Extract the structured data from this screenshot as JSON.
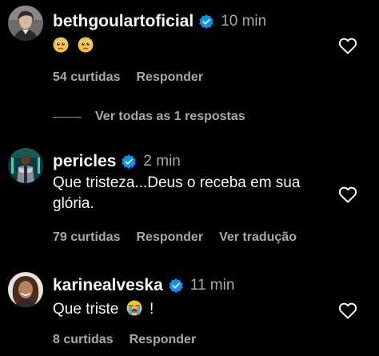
{
  "comments": [
    {
      "username": "bethgoulartoficial",
      "verified": true,
      "time": "10 min",
      "text": "",
      "emoji": [
        "pleading-face-emoji",
        "pleading-face-emoji"
      ],
      "likes": "54 curtidas",
      "reply_label": "Responder",
      "translate_label": ""
    },
    {
      "username": "pericles",
      "verified": true,
      "time": "2 min",
      "text": "Que tristeza...Deus o receba em sua glória.",
      "likes": "79 curtidas",
      "reply_label": "Responder",
      "translate_label": "Ver tradução"
    },
    {
      "username": "karinealveska",
      "verified": true,
      "time": "11 min",
      "text": "Que triste",
      "text_suffix": "!",
      "emoji": [
        "loudly-crying-face-emoji"
      ],
      "likes": "8 curtidas",
      "reply_label": "Responder",
      "translate_label": ""
    }
  ],
  "view_replies": {
    "label": "Ver todas as 1 respostas"
  },
  "colors": {
    "background": "#000000",
    "text_primary": "#f5f5f5",
    "text_secondary": "#a8a8a8",
    "verified_badge": "#0095f6"
  },
  "icons": {
    "verified": "verified-badge-icon",
    "like": "heart-outline-icon"
  }
}
